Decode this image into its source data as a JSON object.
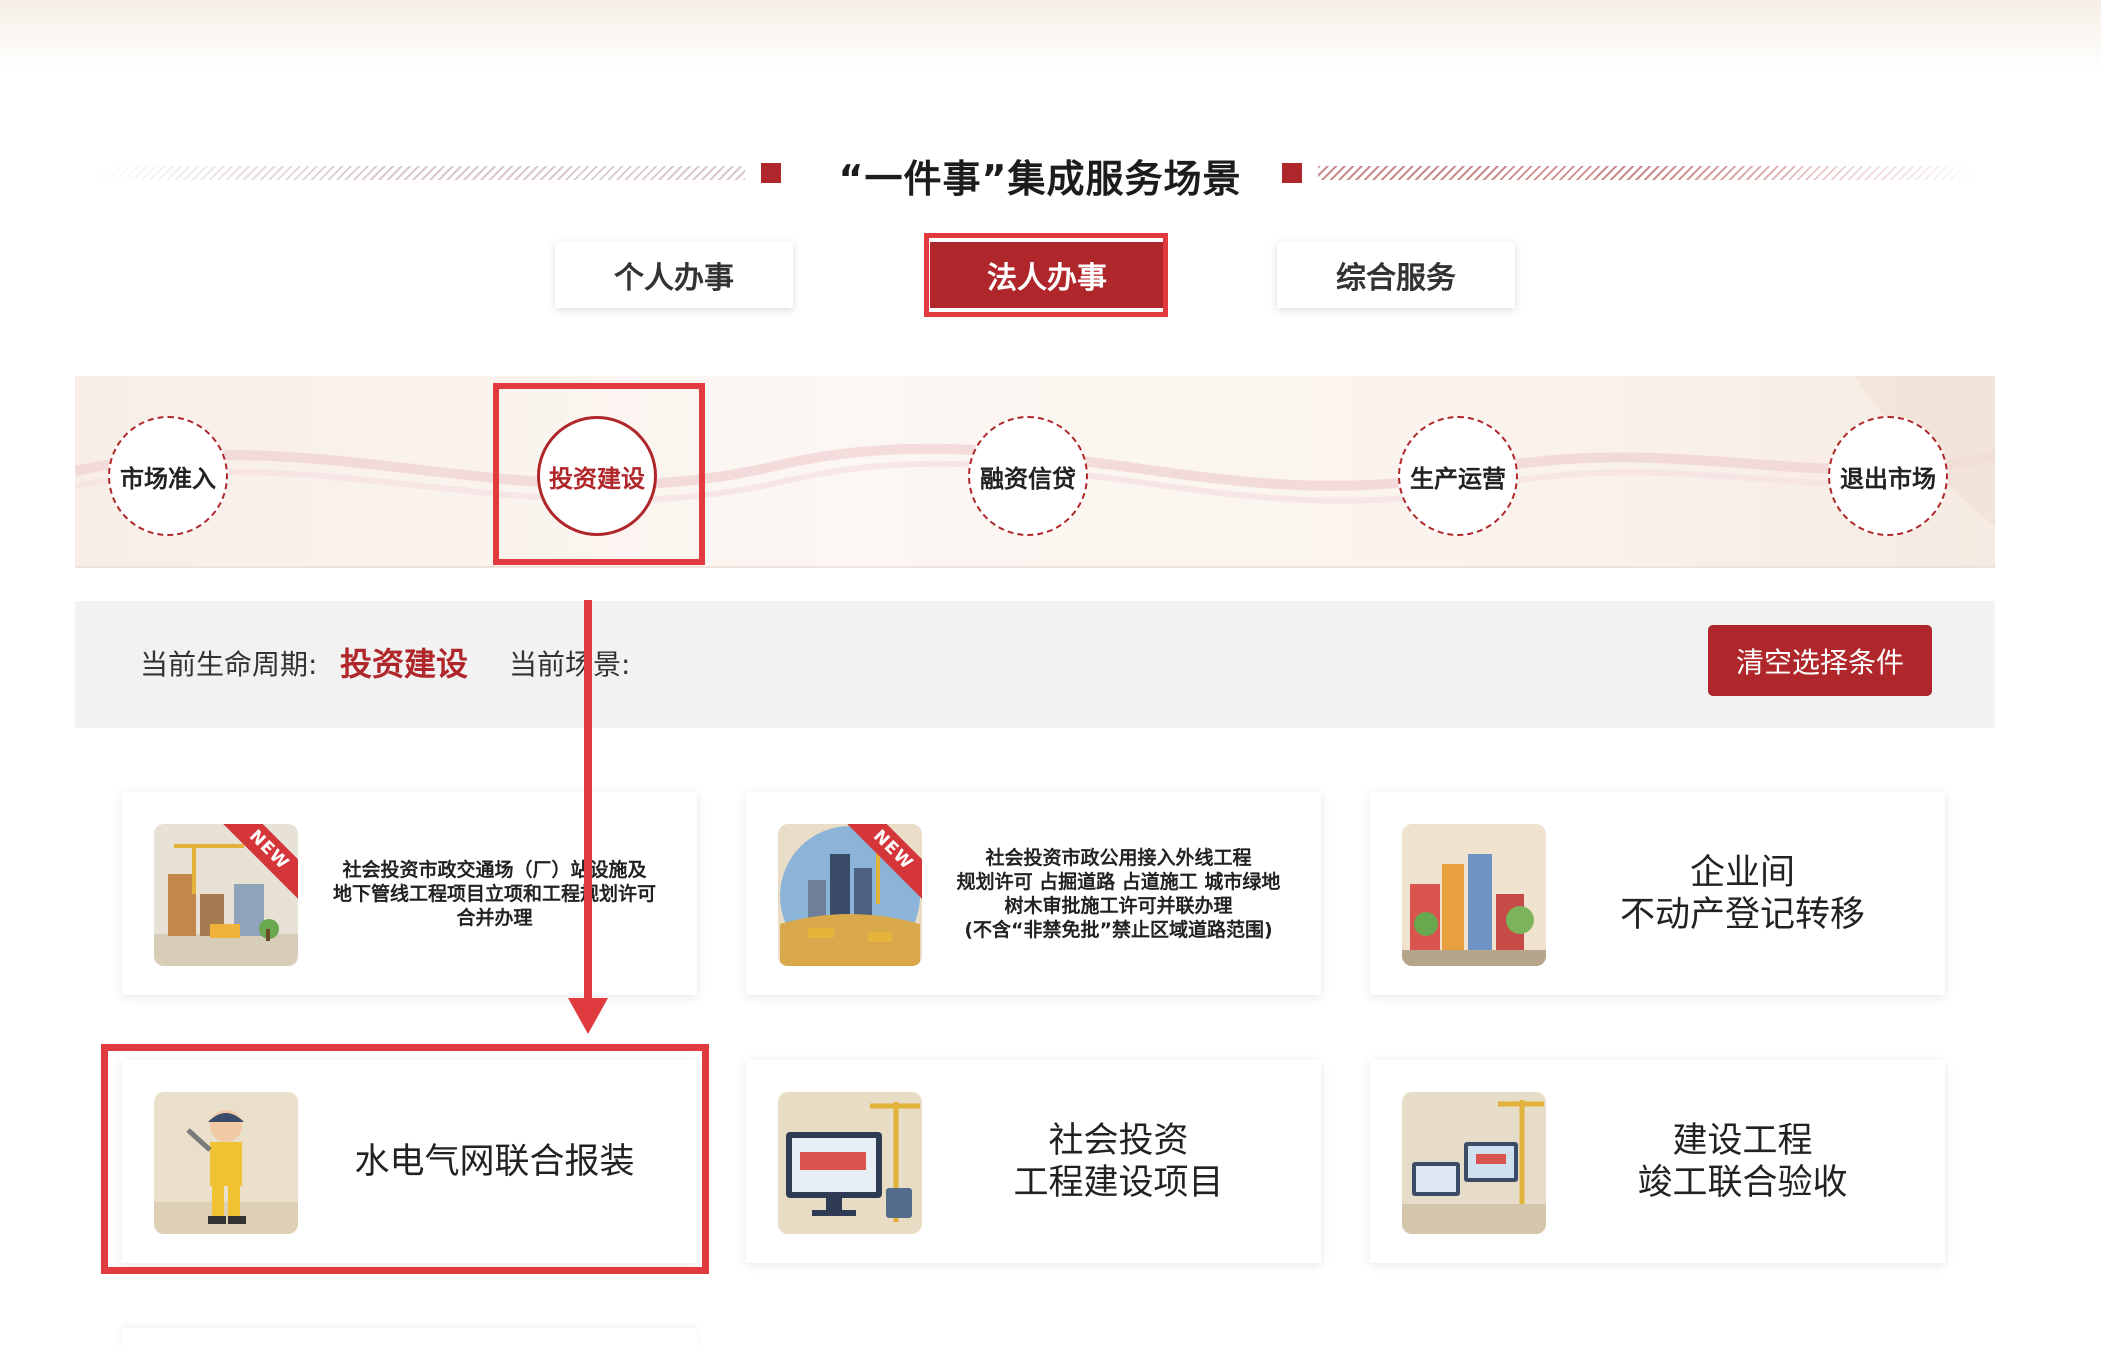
{
  "header": {
    "title": "“一件事”集成服务场景"
  },
  "tabs": [
    {
      "label": "个人办事",
      "active": false
    },
    {
      "label": "法人办事",
      "active": true
    },
    {
      "label": "综合服务",
      "active": false
    }
  ],
  "lifecycle": {
    "items": [
      {
        "label": "市场准入",
        "active": false
      },
      {
        "label": "投资建设",
        "active": true
      },
      {
        "label": "融资信贷",
        "active": false
      },
      {
        "label": "生产运营",
        "active": false
      },
      {
        "label": "退出市场",
        "active": false
      }
    ]
  },
  "filter": {
    "lifecycle_label": "当前生命周期:",
    "lifecycle_value": "投资建设",
    "scene_label": "当前场景:",
    "clear_button": "清空选择条件"
  },
  "cards": [
    {
      "lines": [
        "社会投资市政交通场（厂）站设施及",
        "地下管线工程项目立项和工程规划许可",
        "合并办理"
      ],
      "badge": "NEW",
      "icon": "construction-site-icon"
    },
    {
      "lines": [
        "社会投资市政公用接入外线工程",
        "规划许可 占掘道路 占道施工 城市绿地",
        "树木审批施工许可并联办理",
        "(不含“非禁免批”禁止区域道路范围)"
      ],
      "badge": "NEW",
      "icon": "city-construction-icon"
    },
    {
      "lines": [
        "企业间",
        "不动产登记转移"
      ],
      "badge": "",
      "icon": "buildings-icon"
    },
    {
      "lines": [
        "水电气网联合报装"
      ],
      "badge": "",
      "icon": "worker-icon"
    },
    {
      "lines": [
        "社会投资",
        "工程建设项目"
      ],
      "badge": "",
      "icon": "computer-crane-icon"
    },
    {
      "lines": [
        "建设工程",
        "竣工联合验收"
      ],
      "badge": "",
      "icon": "devices-crane-icon"
    }
  ],
  "colors": {
    "brand_red": "#b0272b",
    "annotation_red": "#e23b3f"
  }
}
